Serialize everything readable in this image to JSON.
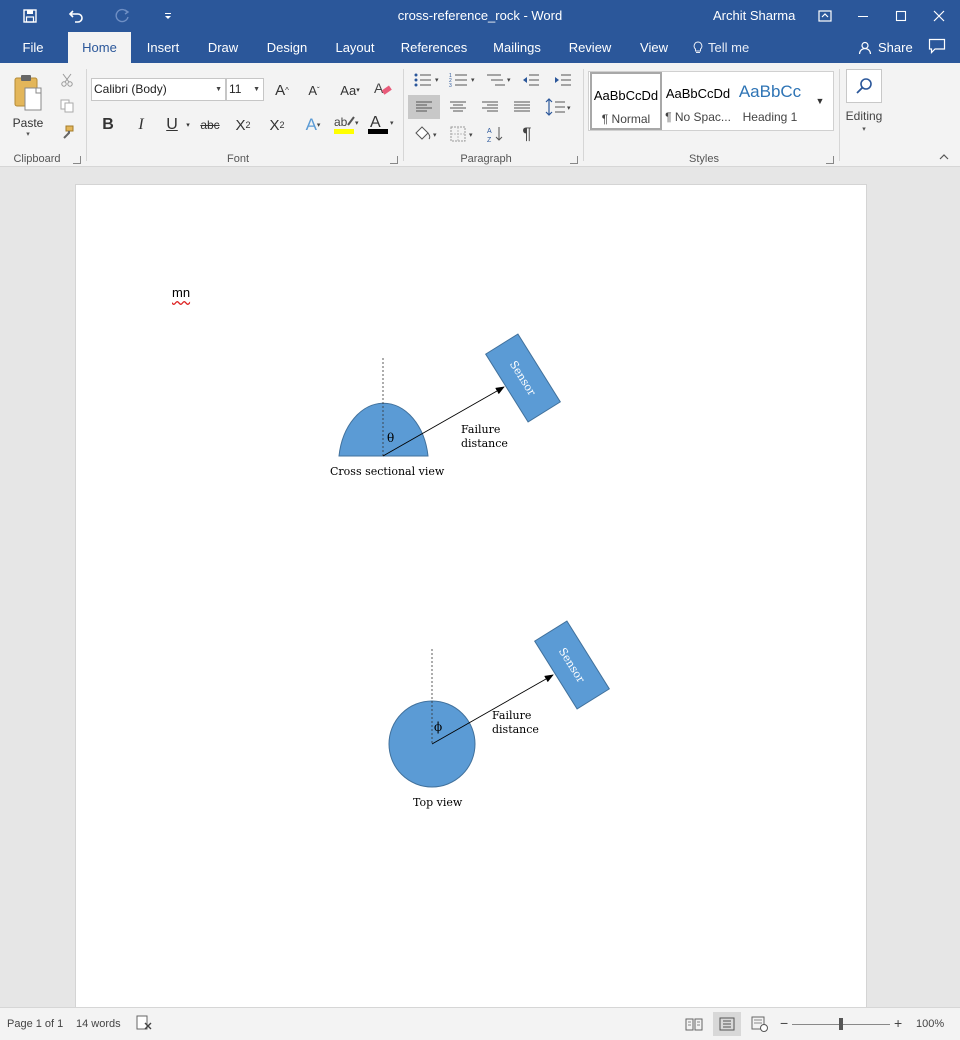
{
  "window": {
    "title": "cross-reference_rock  -  Word",
    "user": "Archit Sharma"
  },
  "tabs": [
    "File",
    "Home",
    "Insert",
    "Draw",
    "Design",
    "Layout",
    "References",
    "Mailings",
    "Review",
    "View"
  ],
  "tell_me": "Tell me",
  "share_label": "Share",
  "ribbon": {
    "clipboard": {
      "paste_label": "Paste",
      "group_label": "Clipboard"
    },
    "font": {
      "font_name": "Calibri (Body)",
      "font_size": "11",
      "group_label": "Font",
      "case_label": "Aa",
      "strike_label": "abc",
      "bold": "B",
      "italic": "I",
      "underline": "U"
    },
    "paragraph": {
      "group_label": "Paragraph"
    },
    "styles": {
      "group_label": "Styles",
      "items": [
        {
          "sample": "AaBbCcDd",
          "name": "¶ Normal"
        },
        {
          "sample": "AaBbCcDd",
          "name": "¶ No Spac..."
        },
        {
          "sample": "AaBbCc",
          "name": "Heading 1"
        }
      ]
    },
    "editing": {
      "label": "Editing"
    }
  },
  "document": {
    "text": "mn",
    "diagram1": {
      "angle_symbol": "θ",
      "arrow_label_line1": "Failure",
      "arrow_label_line2": "distance",
      "sensor_label": "Sensor",
      "caption": "Cross sectional view"
    },
    "diagram2": {
      "angle_symbol": "ϕ",
      "arrow_label_line1": "Failure",
      "arrow_label_line2": "distance",
      "sensor_label": "Sensor",
      "caption": "Top view"
    }
  },
  "status": {
    "page": "Page 1 of 1",
    "words": "14 words",
    "zoom": "100%"
  },
  "colors": {
    "title_bar": "#2b579a",
    "shape_fill": "#5b9bd5",
    "shape_stroke": "#41719c"
  }
}
